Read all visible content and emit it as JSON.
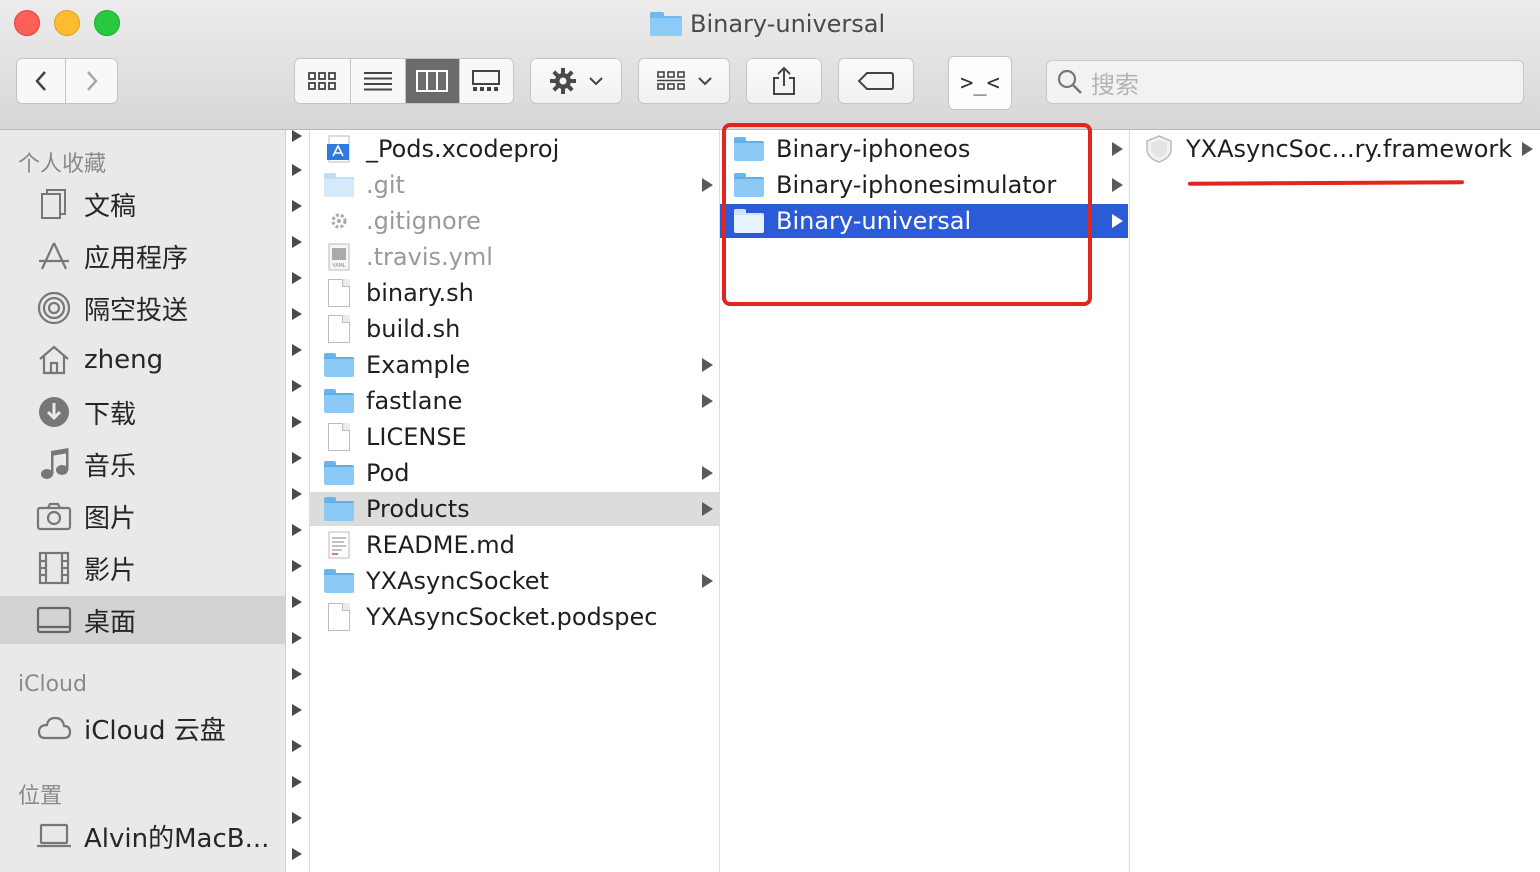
{
  "window": {
    "title": "Binary-universal"
  },
  "toolbar": {
    "back_icon": "chevron-left-icon",
    "forward_icon": "chevron-right-icon",
    "view_modes": [
      "icon-view-icon",
      "list-view-icon",
      "column-view-icon",
      "gallery-view-icon"
    ],
    "selected_view": "column-view-icon",
    "action_icon": "gear-icon",
    "group_icon": "group-by-icon",
    "share_icon": "share-icon",
    "tag_icon": "tag-icon",
    "terminal_label": ">_<",
    "search_placeholder": "搜索"
  },
  "sidebar": {
    "favorites_header": "个人收藏",
    "favorites": [
      {
        "label": "文稿",
        "icon": "document-icon"
      },
      {
        "label": "应用程序",
        "icon": "applications-icon"
      },
      {
        "label": "隔空投送",
        "icon": "airdrop-icon"
      },
      {
        "label": "zheng",
        "icon": "home-icon"
      },
      {
        "label": "下载",
        "icon": "download-icon"
      },
      {
        "label": "音乐",
        "icon": "music-icon"
      },
      {
        "label": "图片",
        "icon": "camera-icon"
      },
      {
        "label": "影片",
        "icon": "film-icon"
      },
      {
        "label": "桌面",
        "icon": "desktop-icon",
        "selected": true
      }
    ],
    "icloud_header": "iCloud",
    "icloud": [
      {
        "label": "iCloud 云盘",
        "icon": "cloud-icon"
      }
    ],
    "locations_header": "位置",
    "locations": [
      {
        "label": "Alvin的MacB...",
        "icon": "laptop-icon"
      }
    ]
  },
  "column1": {
    "items": [
      {
        "name": "_Pods.xcodeproj",
        "kind": "xcodeproj",
        "dim": false,
        "folder": false
      },
      {
        "name": ".git",
        "kind": "folder",
        "dim": true,
        "folder": true
      },
      {
        "name": ".gitignore",
        "kind": "gear-file",
        "dim": true,
        "folder": false
      },
      {
        "name": ".travis.yml",
        "kind": "yaml",
        "dim": true,
        "folder": false
      },
      {
        "name": "binary.sh",
        "kind": "file",
        "dim": false,
        "folder": false
      },
      {
        "name": "build.sh",
        "kind": "file",
        "dim": false,
        "folder": false
      },
      {
        "name": "Example",
        "kind": "folder",
        "dim": false,
        "folder": true
      },
      {
        "name": "fastlane",
        "kind": "folder",
        "dim": false,
        "folder": true
      },
      {
        "name": "LICENSE",
        "kind": "file",
        "dim": false,
        "folder": false
      },
      {
        "name": "Pod",
        "kind": "folder",
        "dim": false,
        "folder": true
      },
      {
        "name": "Products",
        "kind": "folder",
        "dim": false,
        "folder": true,
        "highlighted": true
      },
      {
        "name": "README.md",
        "kind": "text",
        "dim": false,
        "folder": false
      },
      {
        "name": "YXAsyncSocket",
        "kind": "folder",
        "dim": false,
        "folder": true
      },
      {
        "name": "YXAsyncSocket.podspec",
        "kind": "file",
        "dim": false,
        "folder": false
      }
    ]
  },
  "column2": {
    "items": [
      {
        "name": "Binary-iphoneos",
        "folder": true
      },
      {
        "name": "Binary-iphonesimulator",
        "folder": true
      },
      {
        "name": "Binary-universal",
        "folder": true,
        "selected": true
      }
    ]
  },
  "column3": {
    "items": [
      {
        "name": "YXAsyncSoc...ry.framework",
        "kind": "framework",
        "folder": true
      }
    ]
  },
  "annotations": {
    "box_color": "#e0261e"
  },
  "colors": {
    "selection": "#2b5bd7",
    "folder": "#8cc9f4"
  }
}
